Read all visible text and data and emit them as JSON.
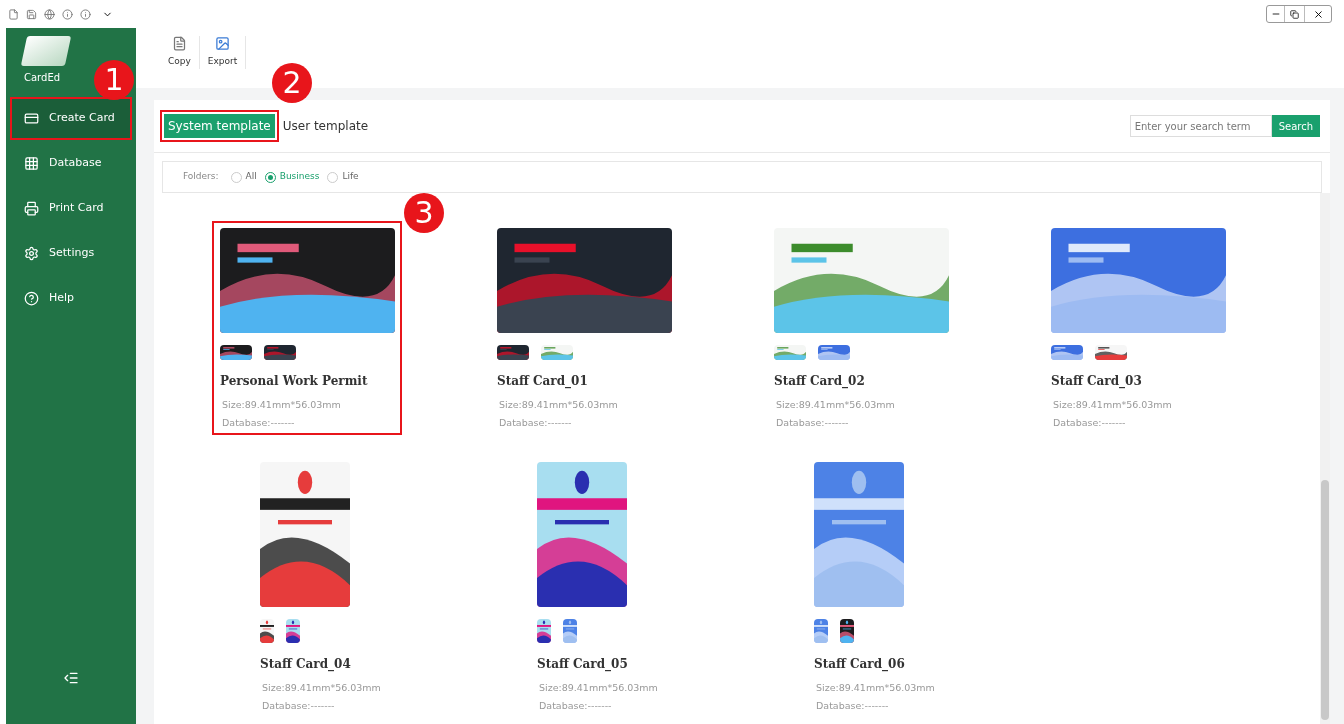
{
  "sidebar": {
    "app_name": "CardEd",
    "items": [
      {
        "label": "Create Card",
        "selected": true,
        "highlighted": true
      },
      {
        "label": "Database",
        "selected": false,
        "highlighted": false
      },
      {
        "label": "Print Card",
        "selected": false,
        "highlighted": false
      },
      {
        "label": "Settings",
        "selected": false,
        "highlighted": false
      },
      {
        "label": "Help",
        "selected": false,
        "highlighted": false
      }
    ]
  },
  "toolbar": [
    {
      "label": "Copy"
    },
    {
      "label": "Export"
    }
  ],
  "tabs": [
    {
      "label": "System template",
      "selected": true,
      "highlighted": true
    },
    {
      "label": "User template",
      "selected": false,
      "highlighted": false
    }
  ],
  "search": {
    "placeholder": "Enter your search term",
    "button": "Search"
  },
  "folders": {
    "label": "Folders:",
    "options": [
      {
        "label": "All",
        "selected": false
      },
      {
        "label": "Business",
        "selected": true
      },
      {
        "label": "Life",
        "selected": false
      }
    ]
  },
  "templates": [
    {
      "name": "Personal Work Permit",
      "size": "Size:89.41mm*56.03mm",
      "database": "Database:-------",
      "kind": "landscape",
      "highlighted": true
    },
    {
      "name": "Staff Card_01",
      "size": "Size:89.41mm*56.03mm",
      "database": "Database:-------",
      "kind": "landscape",
      "highlighted": false
    },
    {
      "name": "Staff Card_02",
      "size": "Size:89.41mm*56.03mm",
      "database": "Database:-------",
      "kind": "landscape",
      "highlighted": false
    },
    {
      "name": "Staff Card_03",
      "size": "Size:89.41mm*56.03mm",
      "database": "Database:-------",
      "kind": "landscape",
      "highlighted": false
    },
    {
      "name": "Staff Card_04",
      "size": "Size:89.41mm*56.03mm",
      "database": "Database:-------",
      "kind": "portrait",
      "highlighted": false
    },
    {
      "name": "Staff Card_05",
      "size": "Size:89.41mm*56.03mm",
      "database": "Database:-------",
      "kind": "portrait",
      "highlighted": false
    },
    {
      "name": "Staff Card_06",
      "size": "Size:89.41mm*56.03mm",
      "database": "Database:-------",
      "kind": "portrait",
      "highlighted": false
    }
  ],
  "annotations": [
    "1",
    "2",
    "3"
  ]
}
